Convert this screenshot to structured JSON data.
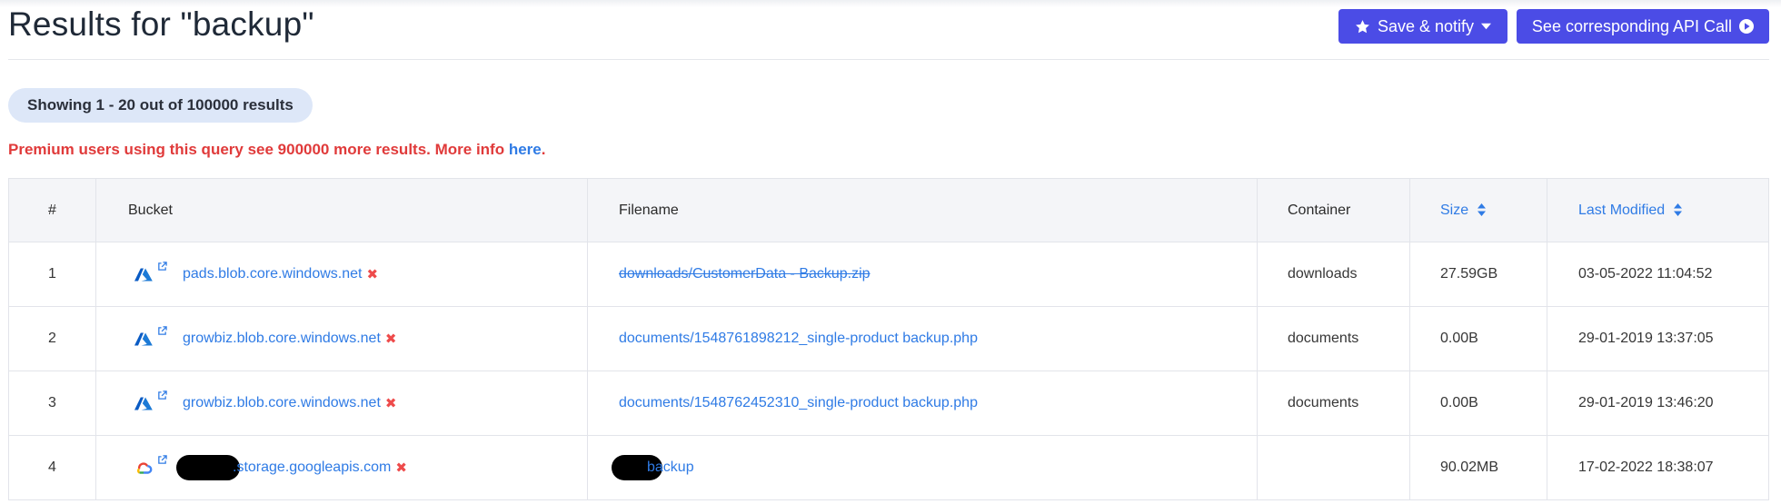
{
  "header": {
    "title": "Results for \"backup\"",
    "save_label": "Save & notify",
    "api_label": "See corresponding API Call"
  },
  "summary": {
    "showing": "Showing 1 - 20 out of 100000 results",
    "premium_text": "Premium users using this query see 900000 more results. More info ",
    "premium_link": "here",
    "premium_end": "."
  },
  "table": {
    "columns": [
      "#",
      "Bucket",
      "Filename",
      "Container",
      "Size",
      "Last Modified"
    ],
    "rows": [
      {
        "num": "1",
        "provider": "azure-icon",
        "bucket": "pads.blob.core.windows.net",
        "filename": "downloads/CustomerData - Backup.zip",
        "container": "downloads",
        "size": "27.59GB",
        "modified": "03-05-2022 11:04:52"
      },
      {
        "num": "2",
        "provider": "azure-icon",
        "bucket": "growbiz.blob.core.windows.net",
        "filename": "documents/1548761898212_single-product backup.php",
        "container": "documents",
        "size": "0.00B",
        "modified": "29-01-2019 13:37:05"
      },
      {
        "num": "3",
        "provider": "azure-icon",
        "bucket": "growbiz.blob.core.windows.net",
        "filename": "documents/1548762452310_single-product backup.php",
        "container": "documents",
        "size": "0.00B",
        "modified": "29-01-2019 13:46:20"
      },
      {
        "num": "4",
        "provider": "google-cloud-icon",
        "bucket": ".storage.googleapis.com",
        "filename": "backup",
        "container": "",
        "size": "90.02MB",
        "modified": "17-02-2022 18:38:07"
      }
    ]
  },
  "colors": {
    "accent": "#4b4ce6",
    "link": "#2f7be5",
    "warning": "#e03a3a",
    "pill": "#dde7f8"
  }
}
